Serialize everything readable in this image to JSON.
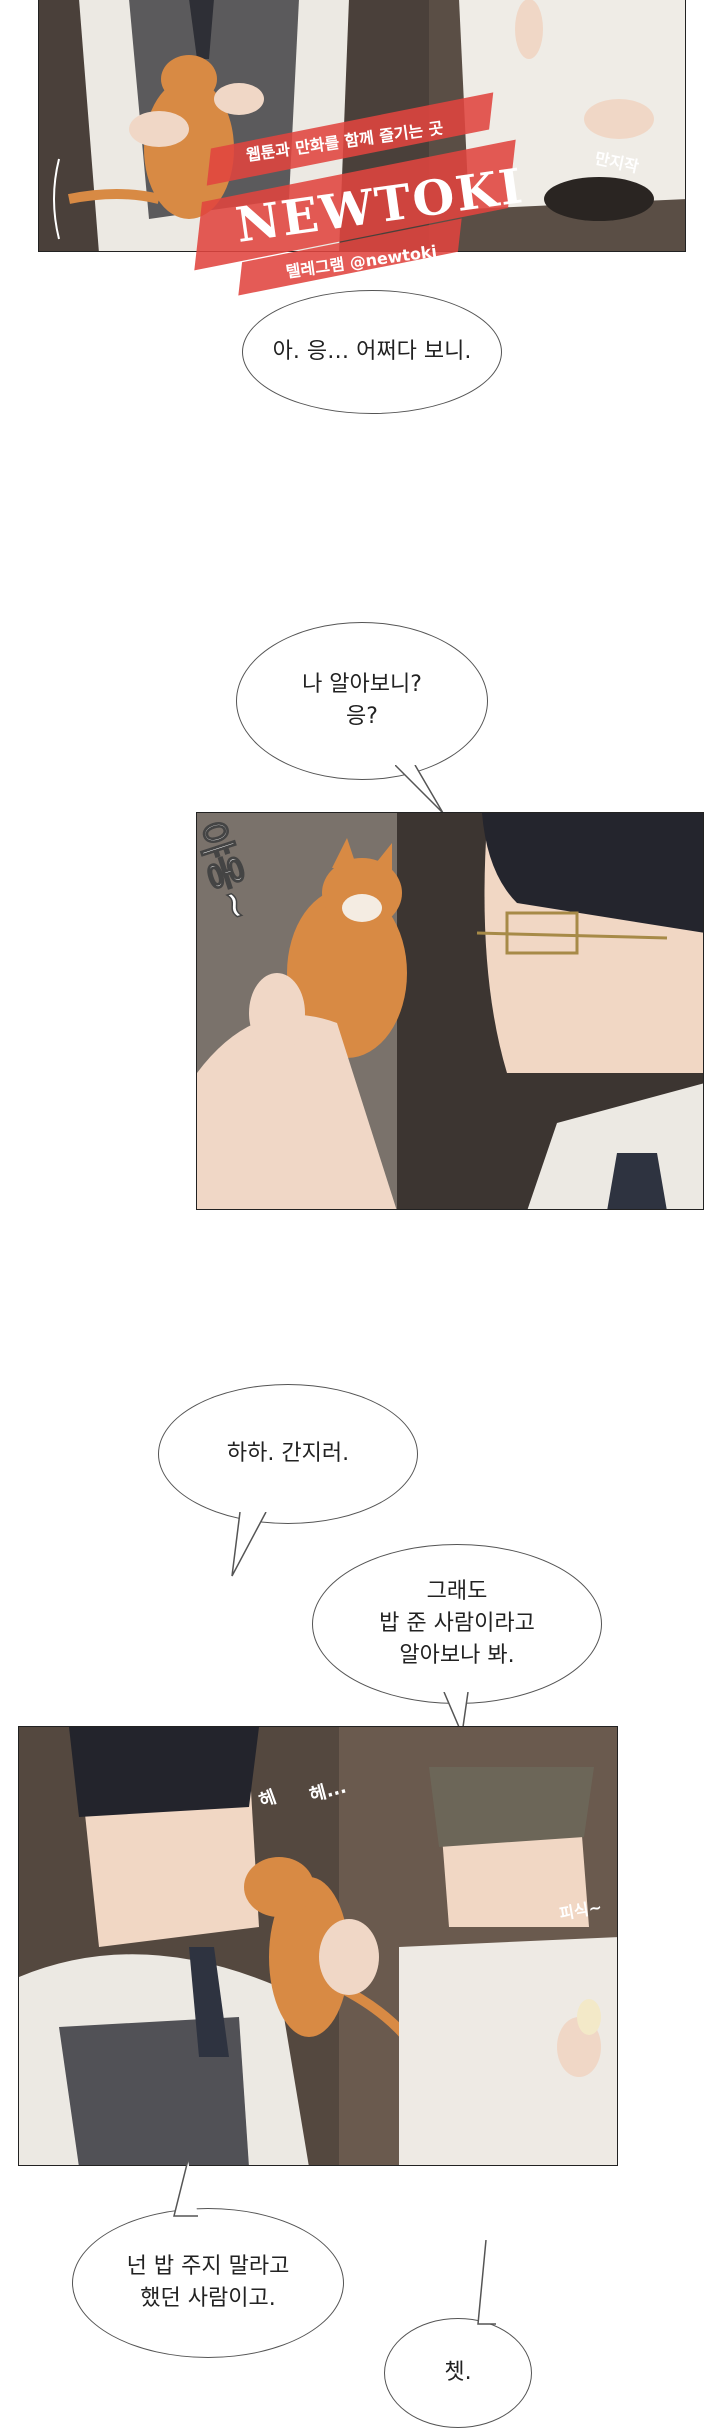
{
  "watermark": {
    "tagline": "웹툰과 만화를 함께 즐기는 곳",
    "brand": "NEWTOKI",
    "handle": "텔레그램 @newtoki"
  },
  "panels": [
    {
      "sfx": [
        "만지작"
      ]
    },
    {
      "sfx": [
        "야옹~"
      ]
    },
    {
      "sfx": [
        "헤",
        "헤...",
        "피식~"
      ]
    }
  ],
  "bubbles": [
    {
      "text": "아. 응… 어쩌다 보니."
    },
    {
      "text": "나 알아보니?\n응?"
    },
    {
      "text": "하하. 간지러."
    },
    {
      "text": "그래도\n밥 준 사람이라고\n알아보나 봐."
    },
    {
      "text": "넌 밥 주지 말라고\n했던 사람이고."
    },
    {
      "text": "쳇."
    }
  ],
  "colors": {
    "watermark_red": "#e0443f",
    "panel_bg_dark": "#3c3531",
    "cat_orange": "#d88a44",
    "shirt_white": "#ece9e3"
  }
}
